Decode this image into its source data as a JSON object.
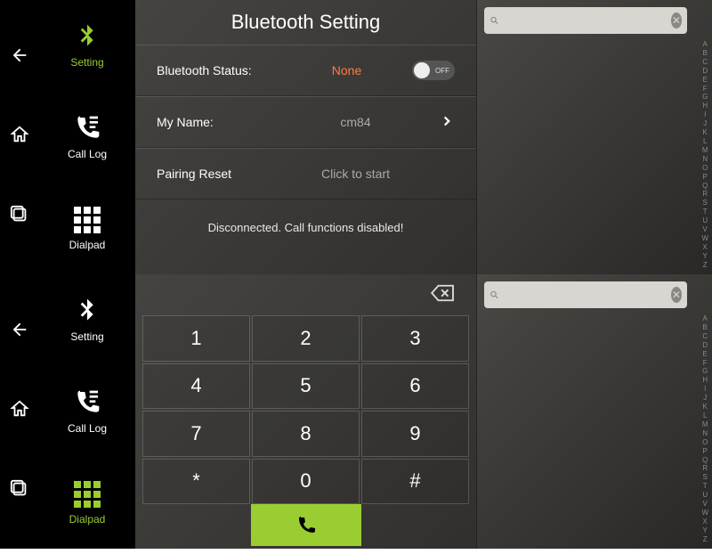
{
  "nav": {
    "setting": "Setting",
    "call_log": "Call Log",
    "dialpad": "Dialpad"
  },
  "bt": {
    "title": "Bluetooth Setting",
    "status_label": "Bluetooth Status:",
    "status_value": "None",
    "toggle_label": "OFF",
    "name_label": "My Name:",
    "name_value": "cm84",
    "pairing_label": "Pairing Reset",
    "pairing_value": "Click to start",
    "disconnected": "Disconnected. Call functions disabled!"
  },
  "keys": {
    "k1": "1",
    "k2": "2",
    "k3": "3",
    "k4": "4",
    "k5": "5",
    "k6": "6",
    "k7": "7",
    "k8": "8",
    "k9": "9",
    "star": "*",
    "k0": "0",
    "hash": "#"
  },
  "search": {
    "placeholder": ""
  },
  "alpha": [
    "A",
    "B",
    "C",
    "D",
    "E",
    "F",
    "G",
    "H",
    "I",
    "J",
    "K",
    "L",
    "M",
    "N",
    "O",
    "P",
    "Q",
    "R",
    "S",
    "T",
    "U",
    "V",
    "W",
    "X",
    "Y",
    "Z"
  ]
}
